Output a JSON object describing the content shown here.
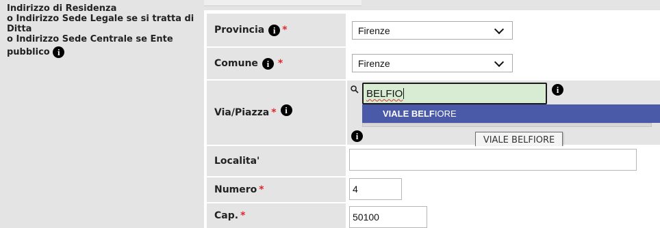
{
  "address_section": {
    "lines": [
      "Indirizzo di Residenza",
      "o Indirizzo Sede Legale se si tratta di",
      "Ditta",
      "o Indirizzo Sede Centrale se Ente",
      "pubblico"
    ],
    "info_glyph": "i"
  },
  "provincia": {
    "label": "Provincia",
    "required": "*",
    "value": "Firenze"
  },
  "comune": {
    "label": "Comune",
    "required": "*",
    "value": "Firenze"
  },
  "via": {
    "label": "Via/Piazza",
    "required": "*",
    "search_value": "BELFIO",
    "suggestion_match": "VIALE BELF",
    "suggestion_rest": "IORE",
    "tooltip": "VIALE BELFIORE"
  },
  "localita": {
    "label": "Localita'",
    "value": ""
  },
  "numero": {
    "label": "Numero",
    "required": "*",
    "value": "4"
  },
  "cap": {
    "label": "Cap.",
    "required": "*",
    "value": "50100"
  },
  "colors": {
    "panel_bg": "#e4e4e4",
    "required": "#e0262b",
    "search_bg": "#d7ecd3",
    "suggestion_bg": "#4a5aa8"
  }
}
